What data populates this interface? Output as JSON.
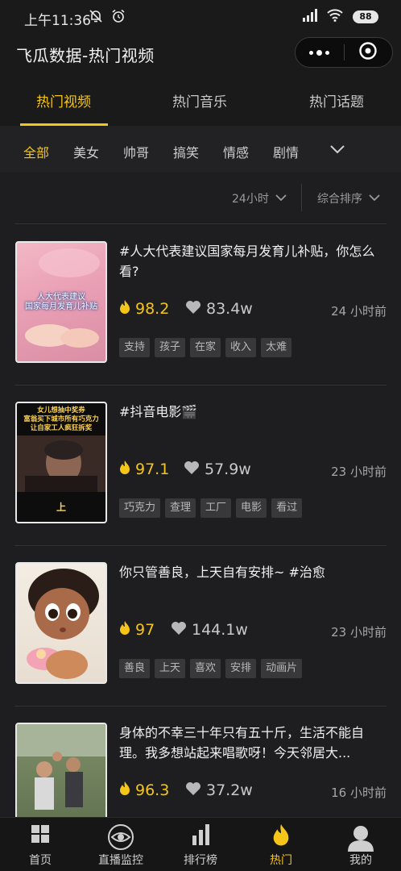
{
  "status_bar": {
    "time": "上午11:36",
    "battery": "88"
  },
  "header": {
    "title": "飞瓜数据-热门视频"
  },
  "main_tabs": [
    {
      "label": "热门视频",
      "active": true
    },
    {
      "label": "热门音乐",
      "active": false
    },
    {
      "label": "热门话题",
      "active": false
    }
  ],
  "categories": [
    {
      "label": "全部",
      "active": true
    },
    {
      "label": "美女"
    },
    {
      "label": "帅哥"
    },
    {
      "label": "搞笑"
    },
    {
      "label": "情感"
    },
    {
      "label": "剧情"
    }
  ],
  "filters": {
    "time_range": "24小时",
    "sort": "综合排序"
  },
  "videos": [
    {
      "title": "#人大代表建议国家每月发育儿补贴，你怎么看?",
      "thumb_text": [
        "人大代表建议",
        "国家每月发育儿补贴"
      ],
      "heat": "98.2",
      "likes": "83.4w",
      "time_ago": "24 小时前",
      "tags": [
        "支持",
        "孩子",
        "在家",
        "收入",
        "太难"
      ]
    },
    {
      "title": "#抖音电影🎬",
      "thumb_text": [
        "女儿想抽中奖券",
        "富翁买下城市所有巧克力",
        "让自家工人疯狂拆奖",
        "上"
      ],
      "heat": "97.1",
      "likes": "57.9w",
      "time_ago": "23 小时前",
      "tags": [
        "巧克力",
        "查理",
        "工厂",
        "电影",
        "看过"
      ]
    },
    {
      "title": "你只管善良，上天自有安排~ #治愈",
      "heat": "97",
      "likes": "144.1w",
      "time_ago": "23 小时前",
      "tags": [
        "善良",
        "上天",
        "喜欢",
        "安排",
        "动画片"
      ]
    },
    {
      "title": "身体的不幸三十年只有五十斤，生活不能自理。我多想站起来唱歌呀！今天邻居大...",
      "heat": "96.3",
      "likes": "37.2w",
      "time_ago": "16 小时前",
      "tags": []
    }
  ],
  "bottom_nav": [
    {
      "label": "首页",
      "icon": "grid-icon"
    },
    {
      "label": "直播监控",
      "icon": "eye-icon"
    },
    {
      "label": "排行榜",
      "icon": "bar-chart-icon"
    },
    {
      "label": "热门",
      "icon": "flame-icon",
      "active": true
    },
    {
      "label": "我的",
      "icon": "user-icon"
    }
  ],
  "colors": {
    "accent": "#f5c518",
    "background": "#1e1e20",
    "bar": "#1a1a1a"
  }
}
